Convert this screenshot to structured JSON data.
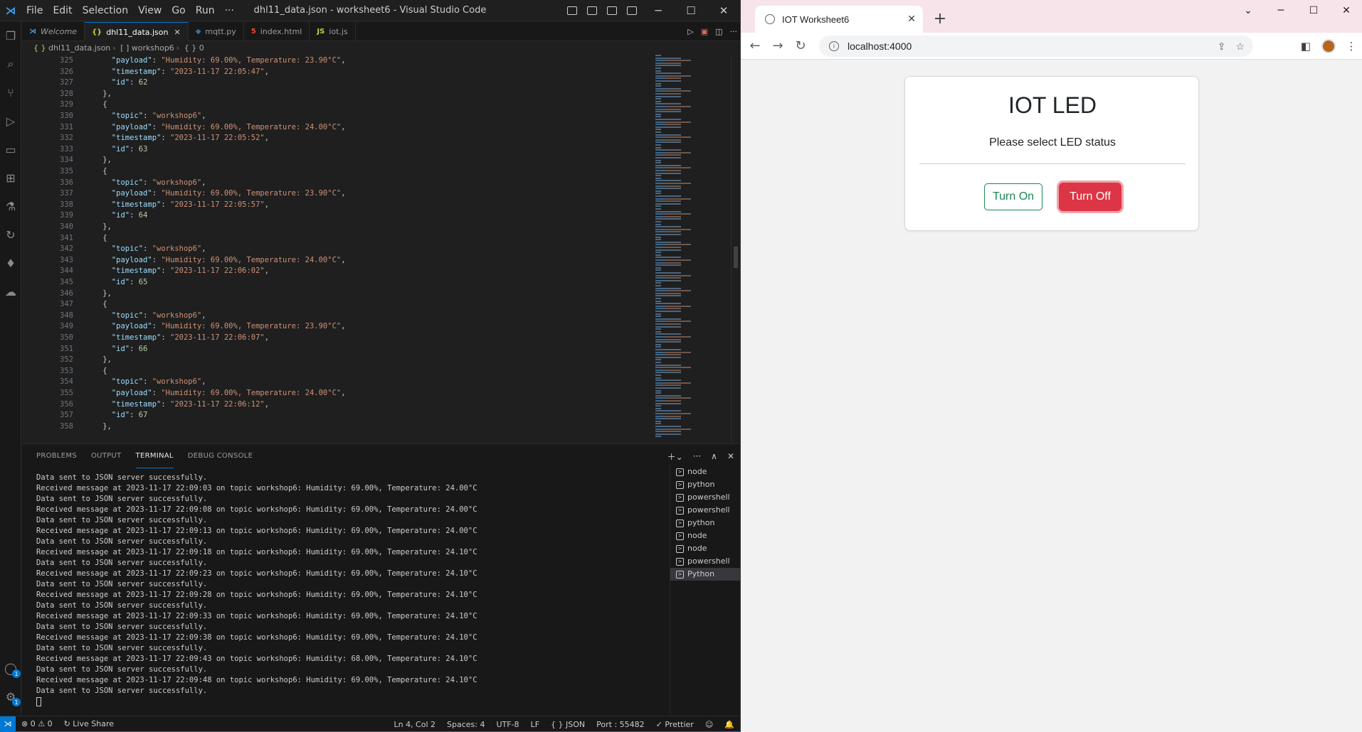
{
  "vscode": {
    "window_title": "dhl11_data.json - worksheet6 - Visual Studio Code",
    "menu": [
      "File",
      "Edit",
      "Selection",
      "View",
      "Go",
      "Run",
      "···"
    ],
    "tabs": [
      {
        "label": "Welcome",
        "icon": "vscode-icon",
        "italic": true
      },
      {
        "label": "dhl11_data.json",
        "icon": "json-icon",
        "active": true
      },
      {
        "label": "mqtt.py",
        "icon": "python-icon"
      },
      {
        "label": "index.html",
        "icon": "html-icon"
      },
      {
        "label": "iot.js",
        "icon": "js-icon"
      }
    ],
    "breadcrumb": [
      "dhl11_data.json",
      "[ ] workshop6",
      "{ } 0"
    ],
    "code": {
      "first_line": 325,
      "lines": [
        {
          "t": "kv",
          "indent": 6,
          "key": "payload",
          "val": "\"Humidity: 69.00%, Temperature: 23.90°C\"",
          "comma": true
        },
        {
          "t": "kv",
          "indent": 6,
          "key": "timestamp",
          "val": "\"2023-11-17 22:05:47\"",
          "comma": true
        },
        {
          "t": "kvn",
          "indent": 6,
          "key": "id",
          "val": "62"
        },
        {
          "t": "p",
          "indent": 4,
          "text": "},"
        },
        {
          "t": "p",
          "indent": 4,
          "text": "{"
        },
        {
          "t": "kv",
          "indent": 6,
          "key": "topic",
          "val": "\"workshop6\"",
          "comma": true
        },
        {
          "t": "kv",
          "indent": 6,
          "key": "payload",
          "val": "\"Humidity: 69.00%, Temperature: 24.00°C\"",
          "comma": true
        },
        {
          "t": "kv",
          "indent": 6,
          "key": "timestamp",
          "val": "\"2023-11-17 22:05:52\"",
          "comma": true
        },
        {
          "t": "kvn",
          "indent": 6,
          "key": "id",
          "val": "63"
        },
        {
          "t": "p",
          "indent": 4,
          "text": "},"
        },
        {
          "t": "p",
          "indent": 4,
          "text": "{"
        },
        {
          "t": "kv",
          "indent": 6,
          "key": "topic",
          "val": "\"workshop6\"",
          "comma": true
        },
        {
          "t": "kv",
          "indent": 6,
          "key": "payload",
          "val": "\"Humidity: 69.00%, Temperature: 23.90°C\"",
          "comma": true
        },
        {
          "t": "kv",
          "indent": 6,
          "key": "timestamp",
          "val": "\"2023-11-17 22:05:57\"",
          "comma": true
        },
        {
          "t": "kvn",
          "indent": 6,
          "key": "id",
          "val": "64"
        },
        {
          "t": "p",
          "indent": 4,
          "text": "},"
        },
        {
          "t": "p",
          "indent": 4,
          "text": "{"
        },
        {
          "t": "kv",
          "indent": 6,
          "key": "topic",
          "val": "\"workshop6\"",
          "comma": true
        },
        {
          "t": "kv",
          "indent": 6,
          "key": "payload",
          "val": "\"Humidity: 69.00%, Temperature: 24.00°C\"",
          "comma": true
        },
        {
          "t": "kv",
          "indent": 6,
          "key": "timestamp",
          "val": "\"2023-11-17 22:06:02\"",
          "comma": true
        },
        {
          "t": "kvn",
          "indent": 6,
          "key": "id",
          "val": "65"
        },
        {
          "t": "p",
          "indent": 4,
          "text": "},"
        },
        {
          "t": "p",
          "indent": 4,
          "text": "{"
        },
        {
          "t": "kv",
          "indent": 6,
          "key": "topic",
          "val": "\"workshop6\"",
          "comma": true
        },
        {
          "t": "kv",
          "indent": 6,
          "key": "payload",
          "val": "\"Humidity: 69.00%, Temperature: 23.90°C\"",
          "comma": true
        },
        {
          "t": "kv",
          "indent": 6,
          "key": "timestamp",
          "val": "\"2023-11-17 22:06:07\"",
          "comma": true
        },
        {
          "t": "kvn",
          "indent": 6,
          "key": "id",
          "val": "66"
        },
        {
          "t": "p",
          "indent": 4,
          "text": "},"
        },
        {
          "t": "p",
          "indent": 4,
          "text": "{"
        },
        {
          "t": "kv",
          "indent": 6,
          "key": "topic",
          "val": "\"workshop6\"",
          "comma": true
        },
        {
          "t": "kv",
          "indent": 6,
          "key": "payload",
          "val": "\"Humidity: 69.00%, Temperature: 24.00°C\"",
          "comma": true
        },
        {
          "t": "kv",
          "indent": 6,
          "key": "timestamp",
          "val": "\"2023-11-17 22:06:12\"",
          "comma": true
        },
        {
          "t": "kvn",
          "indent": 6,
          "key": "id",
          "val": "67"
        },
        {
          "t": "p",
          "indent": 4,
          "text": "},"
        }
      ]
    },
    "panel_tabs": [
      "PROBLEMS",
      "OUTPUT",
      "TERMINAL",
      "DEBUG CONSOLE"
    ],
    "terminal_lines": [
      "Data sent to JSON server successfully.",
      "Received message at 2023-11-17 22:09:03 on topic workshop6: Humidity: 69.00%, Temperature: 24.00°C",
      "Data sent to JSON server successfully.",
      "Received message at 2023-11-17 22:09:08 on topic workshop6: Humidity: 69.00%, Temperature: 24.00°C",
      "Data sent to JSON server successfully.",
      "Received message at 2023-11-17 22:09:13 on topic workshop6: Humidity: 69.00%, Temperature: 24.00°C",
      "Data sent to JSON server successfully.",
      "Received message at 2023-11-17 22:09:18 on topic workshop6: Humidity: 69.00%, Temperature: 24.10°C",
      "Data sent to JSON server successfully.",
      "Received message at 2023-11-17 22:09:23 on topic workshop6: Humidity: 69.00%, Temperature: 24.10°C",
      "Data sent to JSON server successfully.",
      "Received message at 2023-11-17 22:09:28 on topic workshop6: Humidity: 69.00%, Temperature: 24.10°C",
      "Data sent to JSON server successfully.",
      "Received message at 2023-11-17 22:09:33 on topic workshop6: Humidity: 69.00%, Temperature: 24.10°C",
      "Data sent to JSON server successfully.",
      "Received message at 2023-11-17 22:09:38 on topic workshop6: Humidity: 69.00%, Temperature: 24.10°C",
      "Data sent to JSON server successfully.",
      "Received message at 2023-11-17 22:09:43 on topic workshop6: Humidity: 68.00%, Temperature: 24.10°C",
      "Data sent to JSON server successfully.",
      "Received message at 2023-11-17 22:09:48 on topic workshop6: Humidity: 69.00%, Temperature: 24.10°C",
      "Data sent to JSON server successfully."
    ],
    "terminal_instances": [
      "node",
      "python",
      "powershell",
      "powershell",
      "python",
      "node",
      "node",
      "powershell",
      "Python"
    ],
    "status": {
      "problems": "⊗ 0 ⚠ 0",
      "live_share": "Live Share",
      "cursor": "Ln 4, Col 2",
      "spaces": "Spaces: 4",
      "encoding": "UTF-8",
      "eol": "LF",
      "language": "{ }  JSON",
      "port": "Port : 55482",
      "prettier": "✓ Prettier"
    },
    "colors": {
      "accent": "#0078d4",
      "bg": "#1f1f1f",
      "key": "#9cdcfe",
      "string": "#ce9178",
      "number": "#b5cea8"
    }
  },
  "chrome": {
    "tab_title": "IOT Worksheet6",
    "url": "localhost:4000",
    "page": {
      "title": "IOT LED",
      "subtitle": "Please select LED status",
      "btn_on": "Turn On",
      "btn_off": "Turn Off"
    },
    "colors": {
      "tab_strip": "#f7e3ea",
      "success": "#198754",
      "danger": "#dc3545"
    }
  }
}
